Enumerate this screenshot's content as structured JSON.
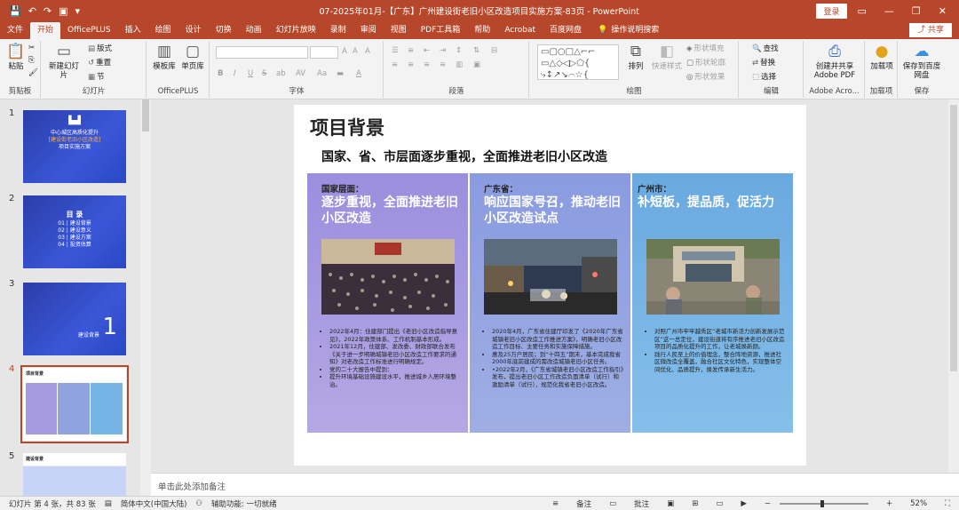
{
  "titlebar": {
    "doc_title": "07-2025年01月-【广东】广州建设街老旧小区改造项目实施方案-83页 - PowerPoint",
    "login_label": "登录",
    "qa_icons": [
      "save-icon",
      "undo-icon",
      "redo-icon",
      "present-icon",
      "customize-icon"
    ],
    "window_icons": [
      "ribbon-display-icon",
      "minimize-icon",
      "maximize-icon",
      "close-icon"
    ]
  },
  "menu": {
    "tabs": [
      "文件",
      "开始",
      "OfficePLUS",
      "插入",
      "绘图",
      "设计",
      "切换",
      "动画",
      "幻灯片放映",
      "录制",
      "审阅",
      "视图",
      "PDF工具箱",
      "帮助",
      "Acrobat",
      "百度网盘"
    ],
    "active_tab": "开始",
    "tell_me": "操作说明搜索",
    "share_label": "共享"
  },
  "ribbon": {
    "clipboard": {
      "paste": "粘贴",
      "label": "剪贴板"
    },
    "slides": {
      "new_slide": "新建幻灯片",
      "layout": "版式",
      "reset": "重置",
      "section": "节",
      "label": "幻灯片"
    },
    "officeplus": {
      "template": "模板库",
      "single": "单页库",
      "label": "OfficePLUS"
    },
    "font": {
      "label": "字体",
      "bold": "B",
      "italic": "I",
      "underline": "U",
      "strike": "S",
      "shadow": "ab",
      "spacing": "AV",
      "case": "Aa",
      "size_up": "A",
      "size_down": "A",
      "clear": "A",
      "color": "A"
    },
    "paragraph": {
      "label": "段落"
    },
    "drawing": {
      "arrange": "排列",
      "quick_styles": "快速样式",
      "fill": "形状填充",
      "outline": "形状轮廓",
      "effects": "形状效果",
      "label": "绘图"
    },
    "editing": {
      "find": "查找",
      "replace": "替换",
      "select": "选择",
      "label": "编辑"
    },
    "adobe": {
      "create_pdf": "创建并共享 Adobe PDF",
      "label": "Adobe Acro..."
    },
    "addins": {
      "addins": "加载项",
      "label": "加载项"
    },
    "save": {
      "save_baidu": "保存到百度网盘",
      "label": "保存"
    }
  },
  "thumbnails": [
    {
      "num": "1",
      "line1": "中心城区高质化提升",
      "line2": "[建设街老旧小区改造]",
      "line3": "项目实施方案"
    },
    {
      "num": "2",
      "title": "目 录",
      "items": [
        "01 | 建设背景",
        "02 | 建设意义",
        "03 | 建设方案",
        "04 | 投资估算"
      ]
    },
    {
      "num": "3",
      "caption": "建设背景",
      "big": "1"
    },
    {
      "num": "4",
      "caption": "项目背景"
    },
    {
      "num": "5",
      "caption": "建设背景"
    }
  ],
  "slide": {
    "title": "项目背景",
    "subtitle": "国家、省、市层面逐步重视，全面推进老旧小区改造",
    "columns": [
      {
        "head": "国家层面：",
        "main": "逐步重视，全面推进老旧小区改造",
        "bullets": [
          "2022年4月：住建部门提出《老旧小区改造指导意见》，2022年政策体系、工作机制基本形成。",
          "2021年12月，住建部、发改委、财政部联合发布《关于进一步明确城镇老旧小区改造工作要求的通知》对老改造工作标准进行明确规定。",
          "党的二十大报告中提到：",
          "提升环境基础设施建设水平，推进城乡人居环境整治。"
        ]
      },
      {
        "head": "广东省：",
        "main": "响应国家号召，推动老旧小区改造试点",
        "bullets": [
          "2020年4月，广东省住建厅印发了《2020年广东省城镇老旧小区改造工作推进方案》，明确老旧小区改造工作目标、主要任务和实施保障措施。",
          "惠及25万户居民；到“十四五”期末，基本完成我省2000年底前建成的需改造城镇老旧小区任务。",
          "•2022年2月，《广东省城镇老旧小区改造工作指引》发布，提出老旧小区工作改造负面清单（试行）和激励清单（试行），规范化我省老旧小区改造。"
        ]
      },
      {
        "head": "广州市：",
        "main": "补短板，提品质，促活力",
        "bullets": [
          "对照广州市牢牢越秀区“老城市新活力创新发展示范区”这一总定位，建设街道将有序推进老旧小区改造项目的品质化提升的工作，让老城焕新颜。",
          "践行人民至上的价值理念，整合阵地资源，推进社区微改造全覆盖，融合社区文化特色，实现整体空间优化、品质提升，焕发传承新生活力。"
        ]
      }
    ]
  },
  "notes_placeholder": "单击此处添加备注",
  "status": {
    "slide_info": "幻灯片 第 4 张，共 83 张",
    "language": "简体中文(中国大陆)",
    "accessibility": "辅助功能: 一切就绪",
    "notes": "备注",
    "comments": "批注",
    "zoom": "52%"
  },
  "colors": {
    "accent": "#b7472a",
    "col1": "#a79be0",
    "col2": "#8fa3e0",
    "col3": "#76b4e6"
  }
}
